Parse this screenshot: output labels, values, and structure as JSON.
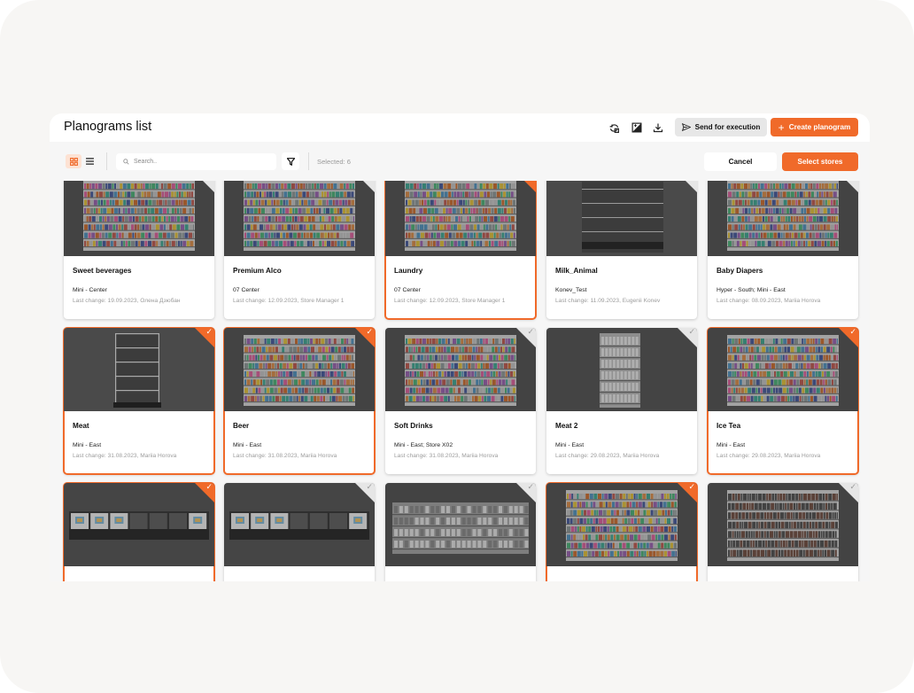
{
  "header": {
    "title": "Planograms list",
    "send_label": "Send for execution",
    "create_label": "Create planogram",
    "icons": [
      "sync-icon",
      "compare-icon",
      "download-icon"
    ]
  },
  "toolbar": {
    "search_placeholder": "Search..",
    "selected_label": "Selected: 6",
    "cancel_label": "Cancel",
    "select_stores_label": "Select stores"
  },
  "colors": {
    "accent": "#f06a2a",
    "thumb_bg": "#4a4a4a",
    "muted_text": "#9c9c9c"
  },
  "cards": [
    {
      "name": "Sweet beverages",
      "stores": "Mini - Center",
      "change": "Last change: 19.09.2023, Олена Дзюбан",
      "selected": false,
      "thumb": "dense"
    },
    {
      "name": "Premium Alco",
      "stores": "07 Center",
      "change": "Last change: 12.09.2023, Store Manager 1",
      "selected": false,
      "thumb": "dense"
    },
    {
      "name": "Laundry",
      "stores": "07 Center",
      "change": "Last change: 12.09.2023, Store Manager 1",
      "selected": true,
      "thumb": "dense"
    },
    {
      "name": "Milk_Animal",
      "stores": "Konev_Test",
      "change": "Last change: 11.09.2023, Eugenii Konev",
      "selected": false,
      "thumb": "empty-wide"
    },
    {
      "name": "Baby Diapers",
      "stores": "Hyper - South; Mini - East",
      "change": "Last change: 08.09.2023, Mariia Horova",
      "selected": false,
      "thumb": "dense"
    },
    {
      "name": "Meat",
      "stores": "Mini - East",
      "change": "Last change: 31.08.2023, Mariia Horova",
      "selected": true,
      "thumb": "empty-narrow"
    },
    {
      "name": "Beer",
      "stores": "Mini - East",
      "change": "Last change: 31.08.2023, Mariia Horova",
      "selected": true,
      "thumb": "dense"
    },
    {
      "name": "Soft Drinks",
      "stores": "Mini - East; Store X02",
      "change": "Last change: 31.08.2023, Mariia Horova",
      "selected": false,
      "thumb": "dense"
    },
    {
      "name": "Meat 2",
      "stores": "Mini - East",
      "change": "Last change: 29.08.2023, Mariia Horova",
      "selected": false,
      "thumb": "narrow"
    },
    {
      "name": "Ice Tea",
      "stores": "Mini - East",
      "change": "Last change: 29.08.2023, Mariia Horova",
      "selected": true,
      "thumb": "dense"
    },
    {
      "name": "",
      "stores": "",
      "change": "",
      "selected": true,
      "thumb": "boxes"
    },
    {
      "name": "",
      "stores": "",
      "change": "",
      "selected": false,
      "thumb": "boxes"
    },
    {
      "name": "",
      "stores": "",
      "change": "",
      "selected": false,
      "thumb": "sparse"
    },
    {
      "name": "",
      "stores": "",
      "change": "",
      "selected": true,
      "thumb": "dense"
    },
    {
      "name": "",
      "stores": "",
      "change": "",
      "selected": false,
      "thumb": "bottles"
    }
  ]
}
